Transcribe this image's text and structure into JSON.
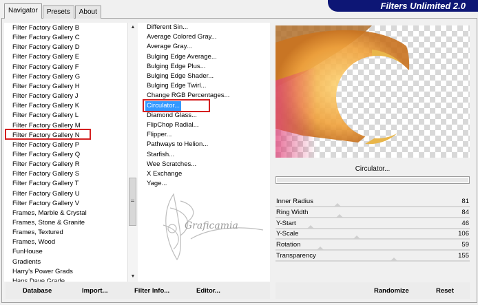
{
  "app": {
    "brand_title": "Filters Unlimited 2.0"
  },
  "tabs": [
    {
      "label": "Navigator"
    },
    {
      "label": "Presets"
    },
    {
      "label": "About"
    }
  ],
  "categories": [
    "Filter Factory Gallery B",
    "Filter Factory Gallery C",
    "Filter Factory Gallery D",
    "Filter Factory Gallery E",
    "Filter Factory Gallery F",
    "Filter Factory Gallery G",
    "Filter Factory Gallery H",
    "Filter Factory Gallery J",
    "Filter Factory Gallery K",
    "Filter Factory Gallery L",
    "Filter Factory Gallery M",
    "Filter Factory Gallery N",
    "Filter Factory Gallery P",
    "Filter Factory Gallery Q",
    "Filter Factory Gallery R",
    "Filter Factory Gallery S",
    "Filter Factory Gallery T",
    "Filter Factory Gallery U",
    "Filter Factory Gallery V",
    "Frames, Marble & Crystal",
    "Frames, Stone & Granite",
    "Frames, Textured",
    "Frames, Wood",
    "FunHouse",
    "Gradients",
    "Harry's Power Grads",
    "Hans Dave Grade"
  ],
  "selected_category_index": 11,
  "effects": [
    "Different Sin...",
    "Average Colored Gray...",
    "Average Gray...",
    "Bulging Edge Average...",
    "Bulging Edge Plus...",
    "Bulging Edge Shader...",
    "Bulging Edge Twirl...",
    "Change RGB Percentages...",
    "Circulator...",
    "Diamond Glass...",
    "FlipChop Radial...",
    "Flipper...",
    "Pathways to Helion...",
    "Starfish...",
    "Wee Scratches...",
    "X Exchange",
    "Yage..."
  ],
  "selected_effect_index": 8,
  "watermark_text": "Graficamia",
  "preview": {
    "effect_name": "Circulator..."
  },
  "sliders": [
    {
      "label": "Inner Radius",
      "value": "81",
      "level": 0.32
    },
    {
      "label": "Ring Width",
      "value": "84",
      "level": 0.33
    },
    {
      "label": "Y-Start",
      "value": "46",
      "level": 0.18
    },
    {
      "label": "Y-Scale",
      "value": "106",
      "level": 0.42
    },
    {
      "label": "Rotation",
      "value": "59",
      "level": 0.23
    },
    {
      "label": "Transparency",
      "value": "155",
      "level": 0.61
    }
  ],
  "buttons": {
    "database": "Database",
    "import": "Import...",
    "filter_info": "Filter Info...",
    "editor": "Editor...",
    "randomize": "Randomize",
    "reset": "Reset"
  },
  "colors": {
    "selection": "#3399ff",
    "highlight_box": "#d41f1f",
    "brand_bg": "#0d1675"
  }
}
